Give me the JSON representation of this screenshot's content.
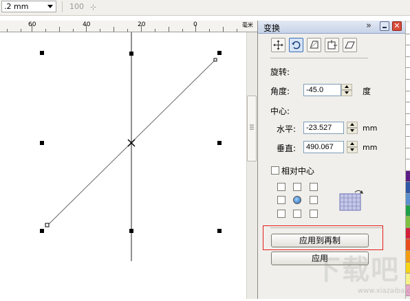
{
  "toolbar": {
    "outline_width": ".2 mm",
    "value_field": "100",
    "value_icon": "⊹"
  },
  "ruler": {
    "labels": [
      "60",
      "40",
      "20",
      "0",
      "毫米"
    ]
  },
  "docker": {
    "title": "变换",
    "collapse_glyph": "»",
    "close_glyph": "✕",
    "modes": [
      "position-icon",
      "rotate-icon",
      "scale-icon",
      "size-icon",
      "skew-icon"
    ],
    "rotate_section": "旋转:",
    "angle_label": "角度:",
    "angle_value": "-45.0",
    "angle_unit": "度",
    "center_section": "中心:",
    "horizontal_label": "水平:",
    "horizontal_value": "-23.527",
    "horizontal_unit": "mm",
    "vertical_label": "垂直:",
    "vertical_value": "490.067",
    "vertical_unit": "mm",
    "relative_center_label": "相对中心",
    "relative_center_checked": false,
    "anchor_selected": "center",
    "apply_duplicate_label": "应用到再制",
    "apply_label": "应用"
  },
  "palette": {
    "colors": [
      "#ffffff",
      "#ffffff",
      "#ffffff",
      "#ffffff",
      "#ffffff",
      "#ffffff",
      "#ffffff",
      "#ffffff",
      "#ffffff",
      "#ffffff",
      "#ffffff",
      "#ffffff",
      "#ffffff",
      "#5b1e84",
      "#2f58a6",
      "#5c8fcf",
      "#1e9f48",
      "#7fbf42",
      "#d21f3c",
      "#e84c1e",
      "#f39c12",
      "#f7d317",
      "#f6f08a",
      "#e6a7c9"
    ]
  },
  "accent": "#e31c1c",
  "watermark": {
    "text": "下载吧",
    "url": "www.xiazaiba.com"
  }
}
